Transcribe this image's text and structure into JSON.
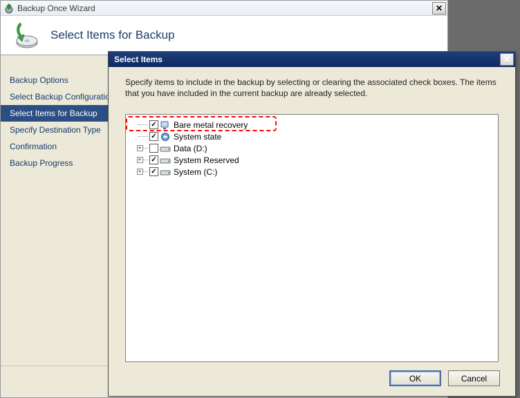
{
  "wizard": {
    "title": "Backup Once Wizard",
    "header_title": "Select Items for Backup",
    "steps": [
      {
        "label": "Backup Options",
        "selected": false
      },
      {
        "label": "Select Backup Configuration",
        "selected": false
      },
      {
        "label": "Select Items for Backup",
        "selected": true
      },
      {
        "label": "Specify Destination Type",
        "selected": false
      },
      {
        "label": "Confirmation",
        "selected": false
      },
      {
        "label": "Backup Progress",
        "selected": false
      }
    ]
  },
  "dialog": {
    "title": "Select Items",
    "instructions": "Specify items to include in the backup by selecting or clearing the associated check boxes. The items that you have included in the current backup are already selected.",
    "tree_items": [
      {
        "label": "Bare metal recovery",
        "checked": true,
        "expandable": false,
        "icon": "bmr",
        "highlighted": true
      },
      {
        "label": "System state",
        "checked": true,
        "expandable": false,
        "icon": "system-state"
      },
      {
        "label": "Data (D:)",
        "checked": false,
        "expandable": true,
        "icon": "drive"
      },
      {
        "label": "System Reserved",
        "checked": true,
        "expandable": true,
        "icon": "drive"
      },
      {
        "label": "System (C:)",
        "checked": true,
        "expandable": true,
        "icon": "drive"
      }
    ],
    "buttons": {
      "ok": "OK",
      "cancel": "Cancel"
    }
  }
}
